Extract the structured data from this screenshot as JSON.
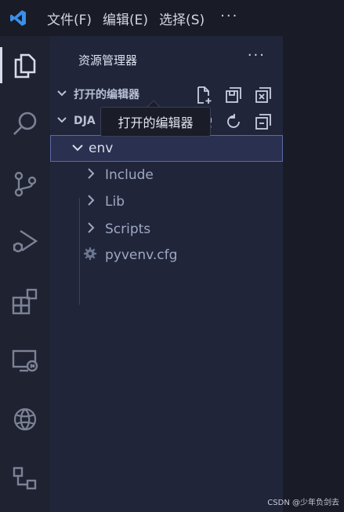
{
  "titlebar": {
    "menu": [
      {
        "label": "文件(F)"
      },
      {
        "label": "编辑(E)"
      },
      {
        "label": "选择(S)"
      }
    ],
    "more": "···"
  },
  "sidebar": {
    "title": "资源管理器",
    "more": "···",
    "open_editors": {
      "label": "打开的编辑器"
    },
    "folder": {
      "label": "DJA"
    },
    "tree": [
      {
        "label": "env",
        "expanded": true
      },
      {
        "label": "Include"
      },
      {
        "label": "Lib"
      },
      {
        "label": "Scripts"
      },
      {
        "label": "pyvenv.cfg"
      }
    ]
  },
  "tooltip": {
    "text": "打开的编辑器"
  },
  "watermark": "CSDN @少年负剑去",
  "colors": {
    "accent": "#3a8fe8",
    "selection_border": "#5a6aa6"
  }
}
